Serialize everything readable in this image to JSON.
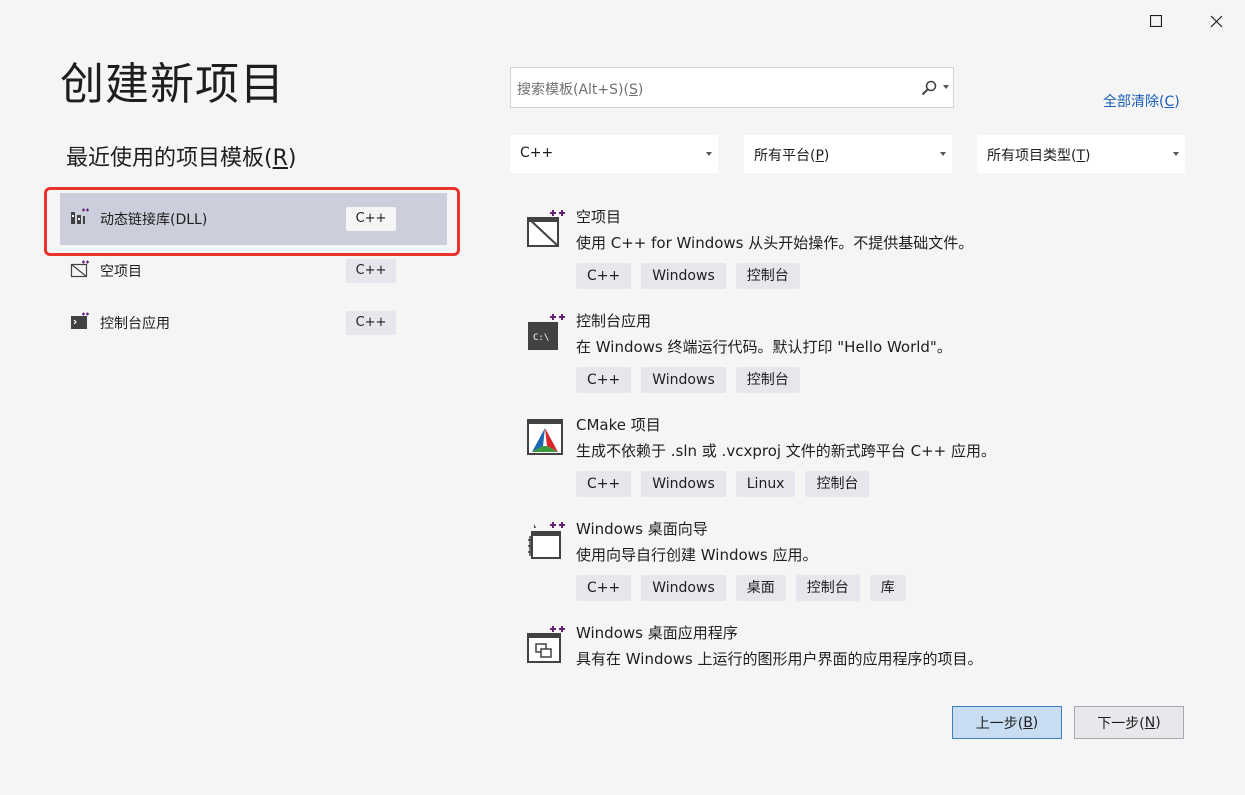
{
  "window": {
    "maximize_icon": "maximize-icon",
    "close_icon": "close-icon"
  },
  "page_title": "创建新项目",
  "recent": {
    "title_prefix": "最近使用的项目模板(",
    "title_mnemonic": "R",
    "title_suffix": ")",
    "items": [
      {
        "label": "动态链接库(DLL)",
        "tag": "C++",
        "icon": "dll-icon",
        "selected": true
      },
      {
        "label": "空项目",
        "tag": "C++",
        "icon": "empty-project-icon",
        "selected": false
      },
      {
        "label": "控制台应用",
        "tag": "C++",
        "icon": "console-app-icon",
        "selected": false
      }
    ]
  },
  "search": {
    "placeholder_prefix": "搜索模板(Alt+S)(",
    "placeholder_mnemonic": "S",
    "placeholder_suffix": ")"
  },
  "clear_all": {
    "prefix": "全部清除(",
    "mnemonic": "C",
    "suffix": ")"
  },
  "filters": {
    "language": {
      "label": "C++"
    },
    "platform": {
      "prefix": "所有平台(",
      "mnemonic": "P",
      "suffix": ")"
    },
    "project_type": {
      "prefix": "所有项目类型(",
      "mnemonic": "T",
      "suffix": ")"
    }
  },
  "templates": [
    {
      "name": "空项目",
      "description": "使用 C++ for Windows 从头开始操作。不提供基础文件。",
      "tags": [
        "C++",
        "Windows",
        "控制台"
      ],
      "icon": "empty-project-icon"
    },
    {
      "name": "控制台应用",
      "description": "在 Windows 终端运行代码。默认打印 \"Hello World\"。",
      "tags": [
        "C++",
        "Windows",
        "控制台"
      ],
      "icon": "console-app-icon"
    },
    {
      "name": "CMake 项目",
      "description": "生成不依赖于 .sln 或 .vcxproj 文件的新式跨平台 C++ 应用。",
      "tags": [
        "C++",
        "Windows",
        "Linux",
        "控制台"
      ],
      "icon": "cmake-icon"
    },
    {
      "name": "Windows 桌面向导",
      "description": "使用向导自行创建 Windows 应用。",
      "tags": [
        "C++",
        "Windows",
        "桌面",
        "控制台",
        "库"
      ],
      "icon": "wizard-icon"
    },
    {
      "name": "Windows 桌面应用程序",
      "description": "具有在 Windows 上运行的图形用户界面的应用程序的项目。",
      "tags": [],
      "icon": "desktop-app-icon"
    }
  ],
  "buttons": {
    "back": {
      "prefix": "上一步(",
      "mnemonic": "B",
      "suffix": ")"
    },
    "next": {
      "prefix": "下一步(",
      "mnemonic": "N",
      "suffix": ")"
    }
  },
  "colors": {
    "accent_link": "#1a5eb8",
    "selected_row": "#cccedb",
    "highlight_border": "#e8352c",
    "purple_plus": "#68217a"
  }
}
